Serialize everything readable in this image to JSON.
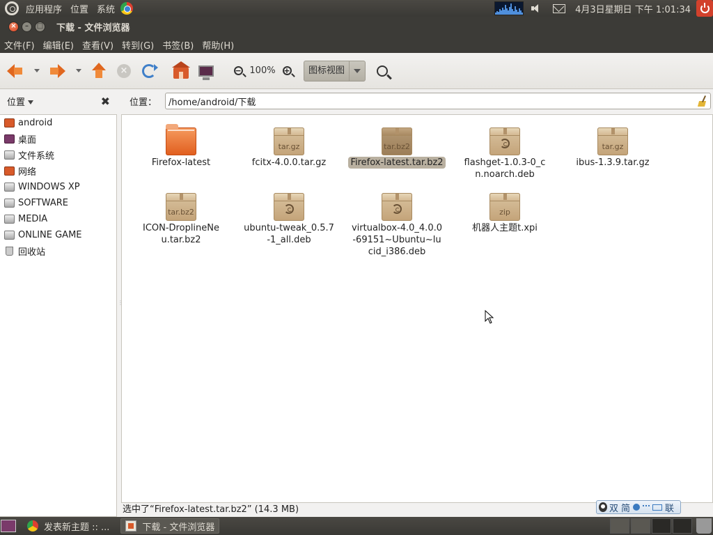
{
  "top_panel": {
    "menus": [
      "应用程序",
      "位置",
      "系统"
    ],
    "clock": "4月3日星期日 下午 1:01:34"
  },
  "window": {
    "title": "下载 - 文件浏览器"
  },
  "menubar": [
    "文件(F)",
    "编辑(E)",
    "查看(V)",
    "转到(G)",
    "书签(B)",
    "帮助(H)"
  ],
  "toolbar": {
    "zoom_level": "100%",
    "view_mode": "图标视图"
  },
  "sidebar": {
    "title": "位置",
    "close_glyph": "✖",
    "items": [
      {
        "label": "android",
        "icon": "home-folder-icon"
      },
      {
        "label": "桌面",
        "icon": "desktop-icon"
      },
      {
        "label": "文件系统",
        "icon": "filesystem-icon"
      },
      {
        "label": "网络",
        "icon": "network-icon"
      },
      {
        "label": "WINDOWS XP",
        "icon": "drive-icon"
      },
      {
        "label": "SOFTWARE",
        "icon": "drive-icon"
      },
      {
        "label": "MEDIA",
        "icon": "drive-icon"
      },
      {
        "label": "ONLINE GAME",
        "icon": "drive-icon"
      },
      {
        "label": "回收站",
        "icon": "trash-icon"
      }
    ]
  },
  "location": {
    "label": "位置：",
    "path": "/home/android/下载"
  },
  "files": [
    {
      "name": "Firefox-latest",
      "type": "folder",
      "ext": ""
    },
    {
      "name": "fcitx-4.0.0.tar.gz",
      "type": "archive",
      "ext": "tar.gz"
    },
    {
      "name": "Firefox-latest.tar.bz2",
      "type": "archive",
      "ext": "tar.bz2",
      "selected": true
    },
    {
      "name": "flashget-1.0.3-0_cn.noarch.deb",
      "type": "deb",
      "ext": ""
    },
    {
      "name": "ibus-1.3.9.tar.gz",
      "type": "archive",
      "ext": "tar.gz"
    },
    {
      "name": "ICON-DroplineNeu.tar.bz2",
      "type": "archive",
      "ext": "tar.bz2"
    },
    {
      "name": "ubuntu-tweak_0.5.7-1_all.deb",
      "type": "deb",
      "ext": ""
    },
    {
      "name": "virtualbox-4.0_4.0.0-69151~Ubuntu~lucid_i386.deb",
      "type": "deb",
      "ext": ""
    },
    {
      "name": "机器人主题t.xpi",
      "type": "archive",
      "ext": "zip"
    }
  ],
  "statusbar": {
    "text": "选中了“Firefox-latest.tar.bz2” (14.3 MB)"
  },
  "ime": {
    "labels": [
      "双",
      "简",
      "联"
    ]
  },
  "taskbar": {
    "tasks": [
      {
        "label": "发表新主题 :: ...",
        "icon": "chrome",
        "active": false
      },
      {
        "label": "下载 - 文件浏览器",
        "icon": "files",
        "active": true
      }
    ]
  }
}
